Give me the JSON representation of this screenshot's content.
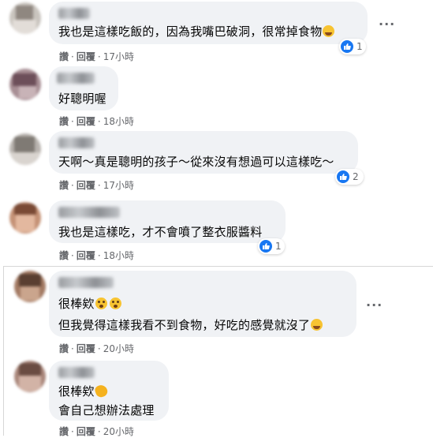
{
  "comments": [
    {
      "text_lines": [
        "我也是這樣吃飯的，因為我嘴巴破洞，很常掉食物"
      ],
      "emoji": "tear",
      "actions": [
        "讚",
        "回覆"
      ],
      "time": "17小時",
      "reaction_count": "1"
    },
    {
      "text_lines": [
        "好聰明喔"
      ],
      "actions": [
        "讚",
        "回覆"
      ],
      "time": "18小時"
    },
    {
      "text_lines": [
        "天啊～真是聰明的孩子～從來沒有想過可以這樣吃～"
      ],
      "actions": [
        "讚",
        "回覆"
      ],
      "time": "17小時",
      "reaction_count": "2"
    },
    {
      "text_lines": [
        "我也是這樣吃，才不會噴了整衣服醬料"
      ],
      "actions": [
        "讚",
        "回覆"
      ],
      "time": "18小時",
      "reaction_count": "1"
    },
    {
      "text_lines": [
        "很棒欸",
        "但我覺得這樣我看不到食物，好吃的感覺就沒了"
      ],
      "actions": [
        "讚",
        "回覆"
      ],
      "time": "20小時"
    },
    {
      "text_lines": [
        "很棒欸",
        "會自己想辦法處理"
      ],
      "actions": [
        "讚",
        "回覆"
      ],
      "time": "20小時"
    }
  ],
  "more_label": "···",
  "colors": {
    "bubble": "#f0f2f5",
    "meta": "#65676b",
    "like_blue": "#1877f2"
  }
}
